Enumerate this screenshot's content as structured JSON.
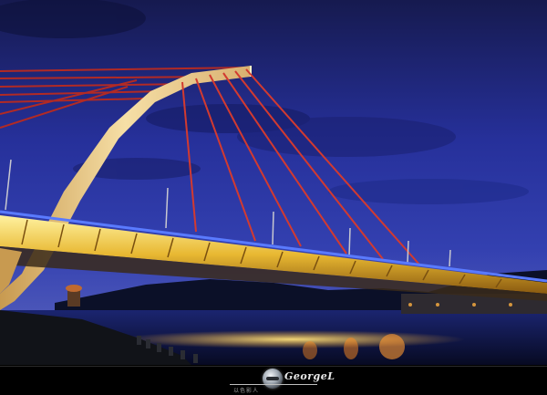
{
  "photo": {
    "subject": "cable-stayed-bridge-at-dusk",
    "colors": {
      "sky_top": "#1a1f5c",
      "sky_mid": "#2a3596",
      "sky_low": "#3d4ab0",
      "arch_light": "#f1d9a0",
      "deck_glow": "#f0c84a",
      "cable_red": "#c0302a",
      "rail_blue": "#4a6bff",
      "water": "#0a1030",
      "reflection": "#ffd060"
    }
  },
  "footer": {
    "watermark_name": "GeorgeL",
    "watermark_caption": "以色影人"
  }
}
